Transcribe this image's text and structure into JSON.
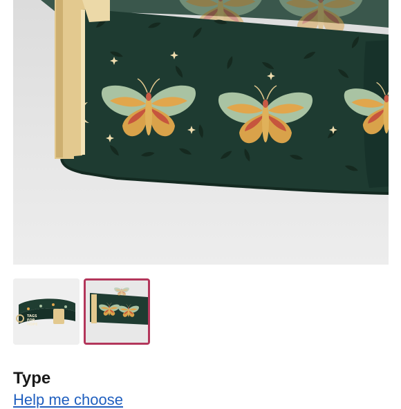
{
  "product_gallery": {
    "main_image_icon": "butterfly-collar-photo",
    "thumbnails": [
      {
        "icon": "collar-thumbnail",
        "selected": false,
        "brand_text": [
          "TAGS",
          "FOR",
          "HOPE"
        ]
      },
      {
        "icon": "collar-closeup-thumbnail",
        "selected": true
      }
    ]
  },
  "options": {
    "section_title": "Type",
    "help_link": "Help me choose"
  },
  "colors": {
    "fabric": "#1e3b31",
    "buckle": "#e3c98f",
    "selected_border": "#b3365b",
    "link": "#1f5fbf"
  }
}
